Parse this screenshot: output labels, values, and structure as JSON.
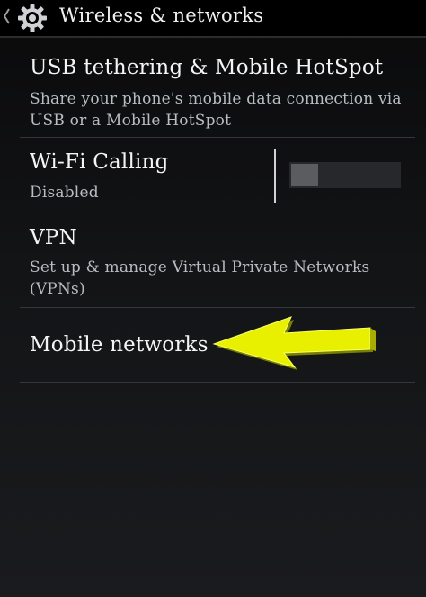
{
  "action_bar": {
    "title": "Wireless & networks",
    "up_icon": "chevron-left-icon",
    "app_icon": "gear-icon"
  },
  "items": [
    {
      "title": "USB tethering & Mobile HotSpot",
      "summary": "Share your phone's mobile data connection via USB or a Mobile HotSpot"
    },
    {
      "title": "Wi-Fi Calling",
      "summary": "Disabled",
      "toggle": {
        "state": "off"
      }
    },
    {
      "title": "VPN",
      "summary": "Set up & manage Virtual Private Networks (VPNs)"
    },
    {
      "title": "Mobile networks"
    }
  ],
  "annotation": {
    "icon": "arrow-left-icon",
    "color": "#e8f000"
  },
  "colors": {
    "background": "#141518",
    "action_bar": "#000000",
    "summary_text": "#b9bcc2",
    "divider": "#33363b"
  }
}
